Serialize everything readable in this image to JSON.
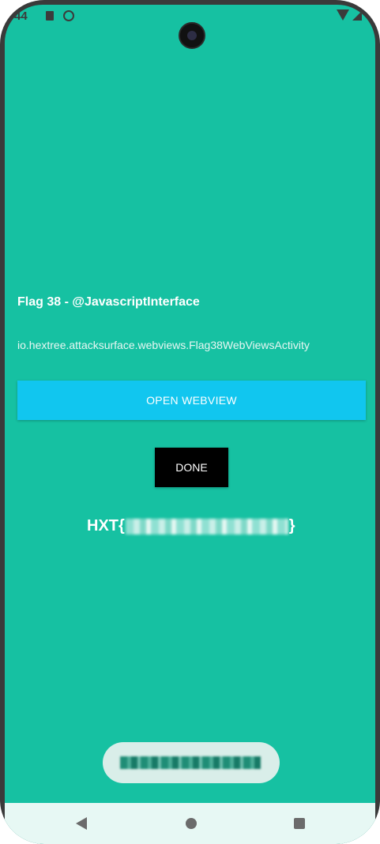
{
  "status_bar": {
    "time": "44"
  },
  "app": {
    "title": "Flag 38 - @JavascriptInterface",
    "activity": "io.hextree.attacksurface.webviews.Flag38WebViewsActivity",
    "open_button": "OPEN WEBVIEW",
    "done_button": "DONE",
    "flag_prefix": "HXT{",
    "flag_suffix": "}"
  },
  "icons": {
    "status": [
      "sd-card-icon",
      "circle-status-icon",
      "wifi-icon",
      "signal-icon"
    ],
    "nav": [
      "back-icon",
      "home-icon",
      "recents-icon"
    ]
  },
  "colors": {
    "background": "#16c1a2",
    "open_button": "#11c6ef",
    "done_button": "#000000",
    "nav_bar": "#e7f8f4"
  }
}
